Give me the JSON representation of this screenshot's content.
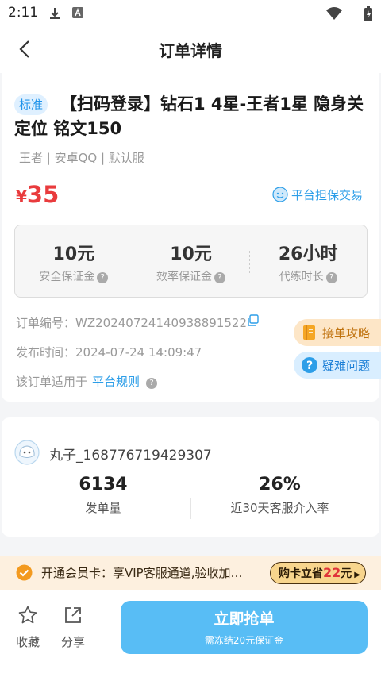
{
  "status_bar": {
    "time": "2:11"
  },
  "nav": {
    "title": "订单详情"
  },
  "order": {
    "tag": "标准",
    "title": "【扫码登录】钻石1 4星-王者1星 隐身关定位 铭文150",
    "meta": "王者 | 安卓QQ | 默认服",
    "price_symbol": "¥",
    "price": "35",
    "guarantee_label": "平台担保交易",
    "stats": [
      {
        "value": "10元",
        "label": "安全保证金"
      },
      {
        "value": "10元",
        "label": "效率保证金"
      },
      {
        "value": "26小时",
        "label": "代练时长"
      }
    ],
    "order_no_label": "订单编号：",
    "order_no": "WZ20240724140938891522",
    "publish_label": "发布时间：",
    "publish_time": "2024-07-24 14:09:47",
    "rule_text": "该订单适用于",
    "rule_link": "平台规则"
  },
  "side_buttons": {
    "guide": "接单攻略",
    "faq": "疑难问题"
  },
  "publisher": {
    "name": "丸子_168776719429307",
    "order_count": "6134",
    "order_count_label": "发单量",
    "intervene_rate": "26%",
    "intervene_label": "近30天客服介入率"
  },
  "vip": {
    "text": "开通会员卡：享VIP客服通道,验收加…",
    "btn_prefix": "购卡立省",
    "btn_amount": "22",
    "btn_suffix": "元"
  },
  "bottom": {
    "favorite": "收藏",
    "share": "分享",
    "grab_main": "立即抢单",
    "grab_sub": "需冻结20元保证金"
  },
  "colors": {
    "accent": "#2d9ee8",
    "price": "#e93b3d",
    "grab": "#58bdf5"
  },
  "icons": [
    "download-icon",
    "notification-icon",
    "wifi-icon",
    "battery-icon",
    "back-icon",
    "help-icon",
    "copy-icon",
    "star-icon",
    "share-icon",
    "check-icon",
    "avatar-icon"
  ]
}
